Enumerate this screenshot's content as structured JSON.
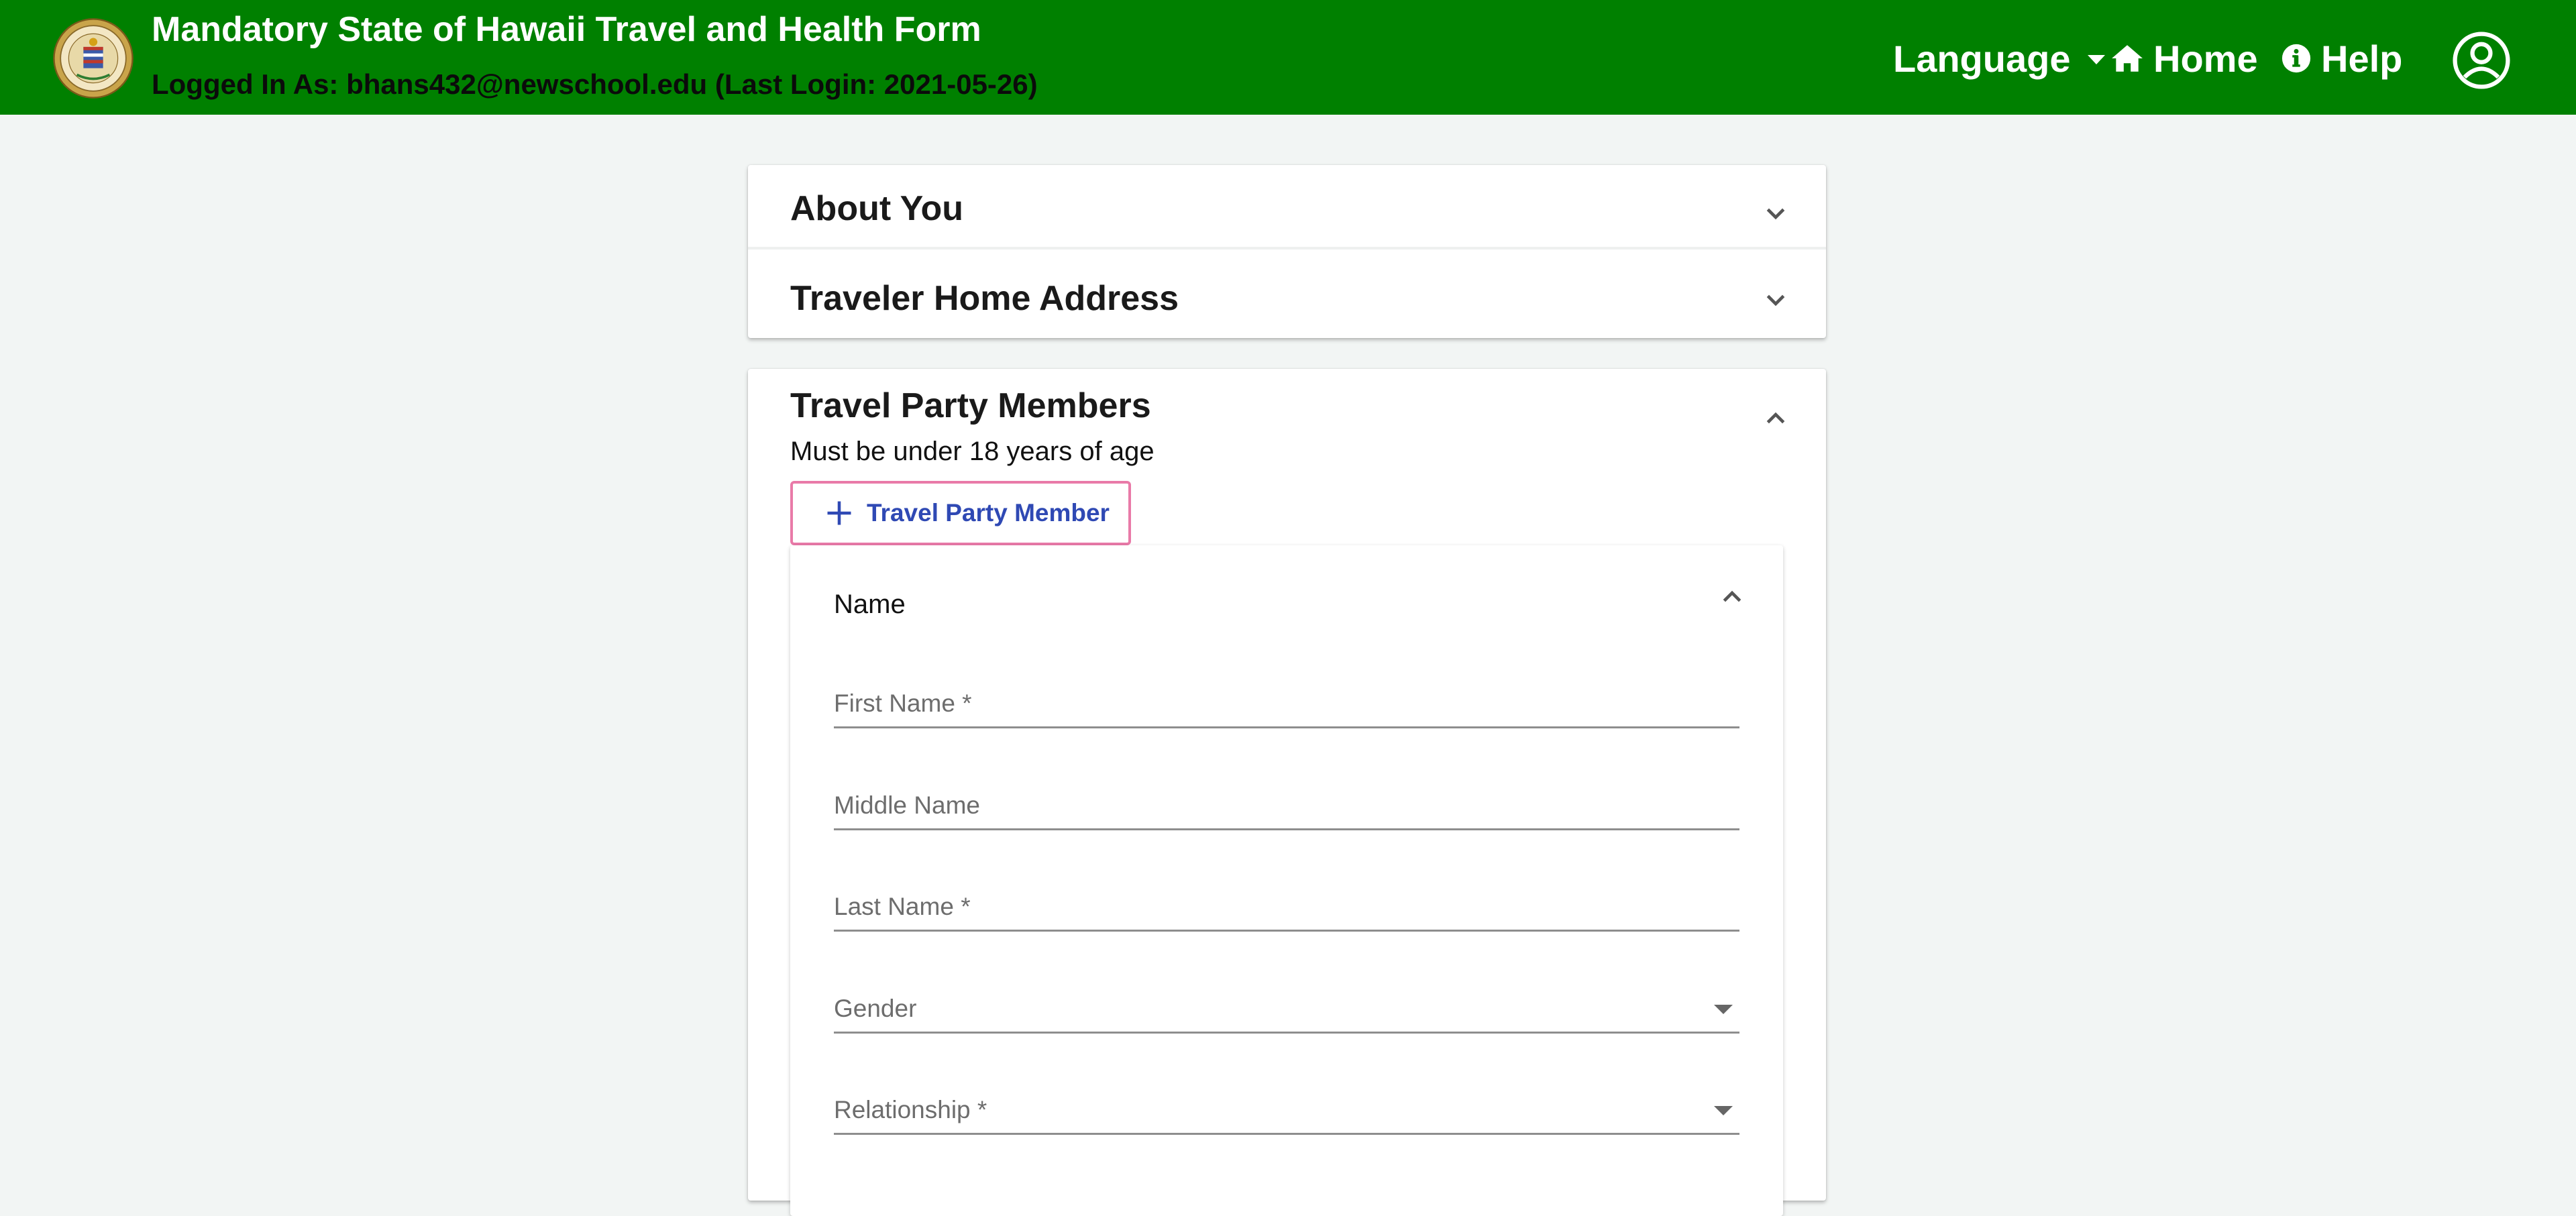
{
  "header": {
    "title": "Mandatory State of Hawaii Travel and Health Form",
    "login_text": "Logged In As: bhans432@newschool.edu (Last Login: 2021-05-26)",
    "logo_icon": "state-seal-icon",
    "nav": {
      "language": "Language",
      "home": "Home",
      "help": "Help"
    },
    "account_icon": "user-circle-icon",
    "brand_color": "#008000"
  },
  "sections": {
    "about": {
      "title": "About You",
      "state": "collapsed"
    },
    "address": {
      "title": "Traveler Home Address",
      "state": "collapsed"
    }
  },
  "party": {
    "title": "Travel Party Members",
    "subtitle": "Must be under 18 years of age",
    "state": "expanded",
    "add_button": "Travel Party Member",
    "member": {
      "section_title": "Name",
      "state": "expanded",
      "fields": {
        "first_name": {
          "label": "First Name *",
          "value": ""
        },
        "middle_name": {
          "label": "Middle Name",
          "value": ""
        },
        "last_name": {
          "label": "Last Name *",
          "value": ""
        },
        "gender": {
          "label": "Gender",
          "value": ""
        },
        "relationship": {
          "label": "Relationship *",
          "value": ""
        }
      }
    }
  }
}
